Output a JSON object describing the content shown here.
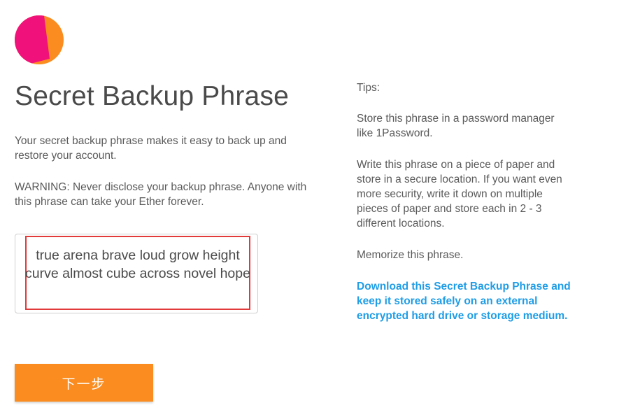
{
  "brand": {
    "logo_colors": {
      "primary": "#fb8c1f",
      "secondary": "#f0127a"
    }
  },
  "main": {
    "title": "Secret Backup Phrase",
    "intro": "Your secret backup phrase makes it easy to back up and restore your account.",
    "warning": "WARNING: Never disclose your backup phrase. Anyone with this phrase can take your Ether forever.",
    "phrase": "true arena brave loud grow height curve almost cube across novel hope",
    "next_button_label": "下一步"
  },
  "tips": {
    "heading": "Tips:",
    "items": [
      "Store this phrase in a password manager like 1Password.",
      "Write this phrase on a piece of paper and store in a secure location. If you want even more security, write it down on multiple pieces of paper and store each in 2 - 3 different locations.",
      "Memorize this phrase."
    ],
    "download_link": "Download this Secret Backup Phrase and keep it stored safely on an external encrypted hard drive or storage medium."
  },
  "colors": {
    "accent": "#fb8c1f",
    "link": "#1f9de6",
    "highlight": "#e23a3a"
  }
}
